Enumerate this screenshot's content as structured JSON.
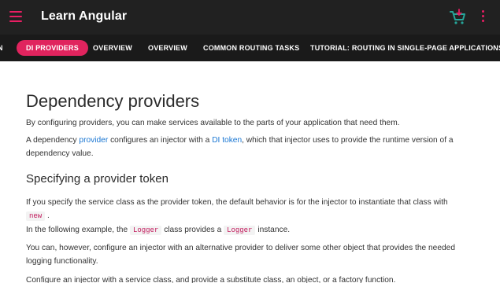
{
  "topbar": {
    "app_title": "Learn Angular",
    "accent": "#e91e63",
    "cart_color": "#26a69a"
  },
  "tabs": [
    {
      "label": "N",
      "active": false
    },
    {
      "label": "DI PROVIDERS",
      "active": true
    },
    {
      "label": "OVERVIEW",
      "active": false
    },
    {
      "label": "OVERVIEW",
      "active": false
    },
    {
      "label": "COMMON ROUTING TASKS",
      "active": false
    },
    {
      "label": "TUTORIAL: ROUTING IN SINGLE-PAGE APPLICATIONS",
      "active": false
    }
  ],
  "content": {
    "title": "Dependency providers",
    "p1": "By configuring providers, you can make services available to the parts of your application that need them.",
    "p2_a": "A dependency ",
    "p2_link1": "provider",
    "p2_b": " configures an injector with a ",
    "p2_link2": "DI token",
    "p2_c": ", which that injector uses to provide the runtime version of a dependency value.",
    "section_title": "Specifying a provider token",
    "p3_a": "If you specify the service class as the provider token, the default behavior is for the injector to instantiate that class with ",
    "p3_code": "new",
    "p3_b": " .",
    "p4_a": "In the following example, the ",
    "p4_code1": "Logger",
    "p4_b": " class provides a ",
    "p4_code2": "Logger",
    "p4_c": " instance.",
    "p5": "You can, however, configure an injector with an alternative provider to deliver some other object that provides the needed logging functionality.",
    "p6": "Configure an injector with a service class, and provide a substitute class, an object, or a factory function."
  }
}
